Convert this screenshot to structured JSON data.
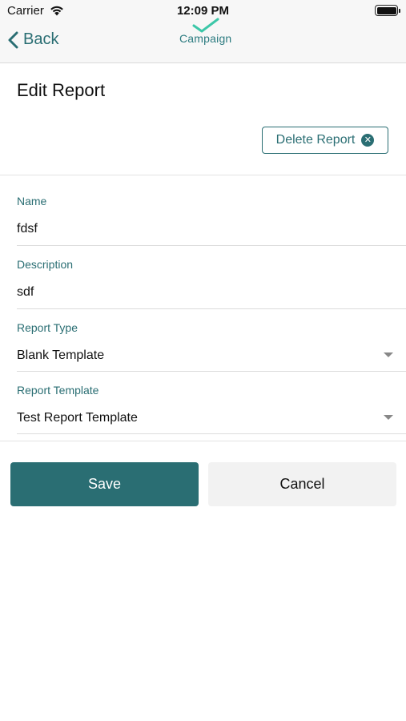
{
  "status_bar": {
    "carrier": "Carrier",
    "time": "12:09 PM"
  },
  "nav": {
    "back_label": "Back",
    "logo_text": "Campaign"
  },
  "page": {
    "title": "Edit Report",
    "delete_label": "Delete Report"
  },
  "form": {
    "name_label": "Name",
    "name_value": "fdsf",
    "description_label": "Description",
    "description_value": "sdf",
    "report_type_label": "Report Type",
    "report_type_value": "Blank Template",
    "report_template_label": "Report Template",
    "report_template_value": "Test Report Template"
  },
  "actions": {
    "save_label": "Save",
    "cancel_label": "Cancel"
  },
  "colors": {
    "accent": "#2a6e73",
    "logo_check": "#3cc7a8",
    "background": "#ffffff"
  }
}
